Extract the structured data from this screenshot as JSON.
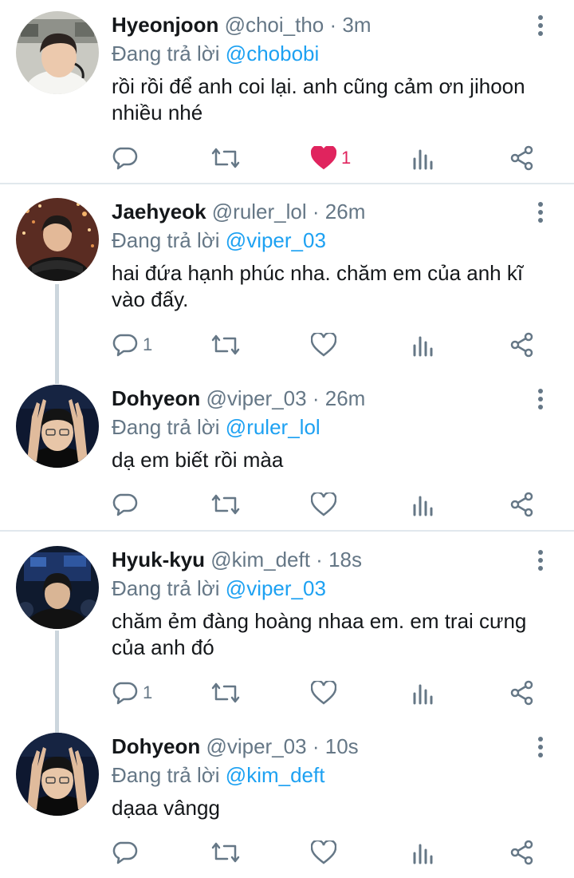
{
  "reply_prefix": "Đang trả lời",
  "tweets": [
    {
      "name": "Hyeonjoon",
      "handle": "@choi_tho",
      "separator": "·",
      "time": "3m",
      "reply_to": "@chobobi",
      "text": "rồi rồi để anh coi lại. anh cũng cảm ơn jihoon nhiều nhé",
      "reply_count": "",
      "like_count": "1",
      "liked": true
    },
    {
      "name": "Jaehyeok",
      "handle": "@ruler_lol",
      "separator": "·",
      "time": "26m",
      "reply_to": "@viper_03",
      "text": "hai đứa hạnh phúc nha. chăm em của anh kĩ vào đấy.",
      "reply_count": "1",
      "like_count": "",
      "liked": false
    },
    {
      "name": "Dohyeon",
      "handle": "@viper_03",
      "separator": "·",
      "time": "26m",
      "reply_to": "@ruler_lol",
      "text": "dạ em biết rồi màa",
      "reply_count": "",
      "like_count": "",
      "liked": false
    },
    {
      "name": "Hyuk-kyu",
      "handle": "@kim_deft",
      "separator": "·",
      "time": "18s",
      "reply_to": "@viper_03",
      "text": "chăm ẻm đàng hoàng nhaa em. em trai cưng của anh đó",
      "reply_count": "1",
      "like_count": "",
      "liked": false
    },
    {
      "name": "Dohyeon",
      "handle": "@viper_03",
      "separator": "·",
      "time": "10s",
      "reply_to": "@kim_deft",
      "text": "dạaa vângg",
      "reply_count": "",
      "like_count": "",
      "liked": false
    }
  ],
  "colors": {
    "accent": "#1da1f2",
    "like": "#e0245e",
    "secondary_text": "#657786",
    "divider": "#e1e8ed"
  },
  "icons": [
    "more-vertical-icon",
    "reply-icon",
    "retweet-icon",
    "like-icon",
    "analytics-icon",
    "share-icon"
  ]
}
